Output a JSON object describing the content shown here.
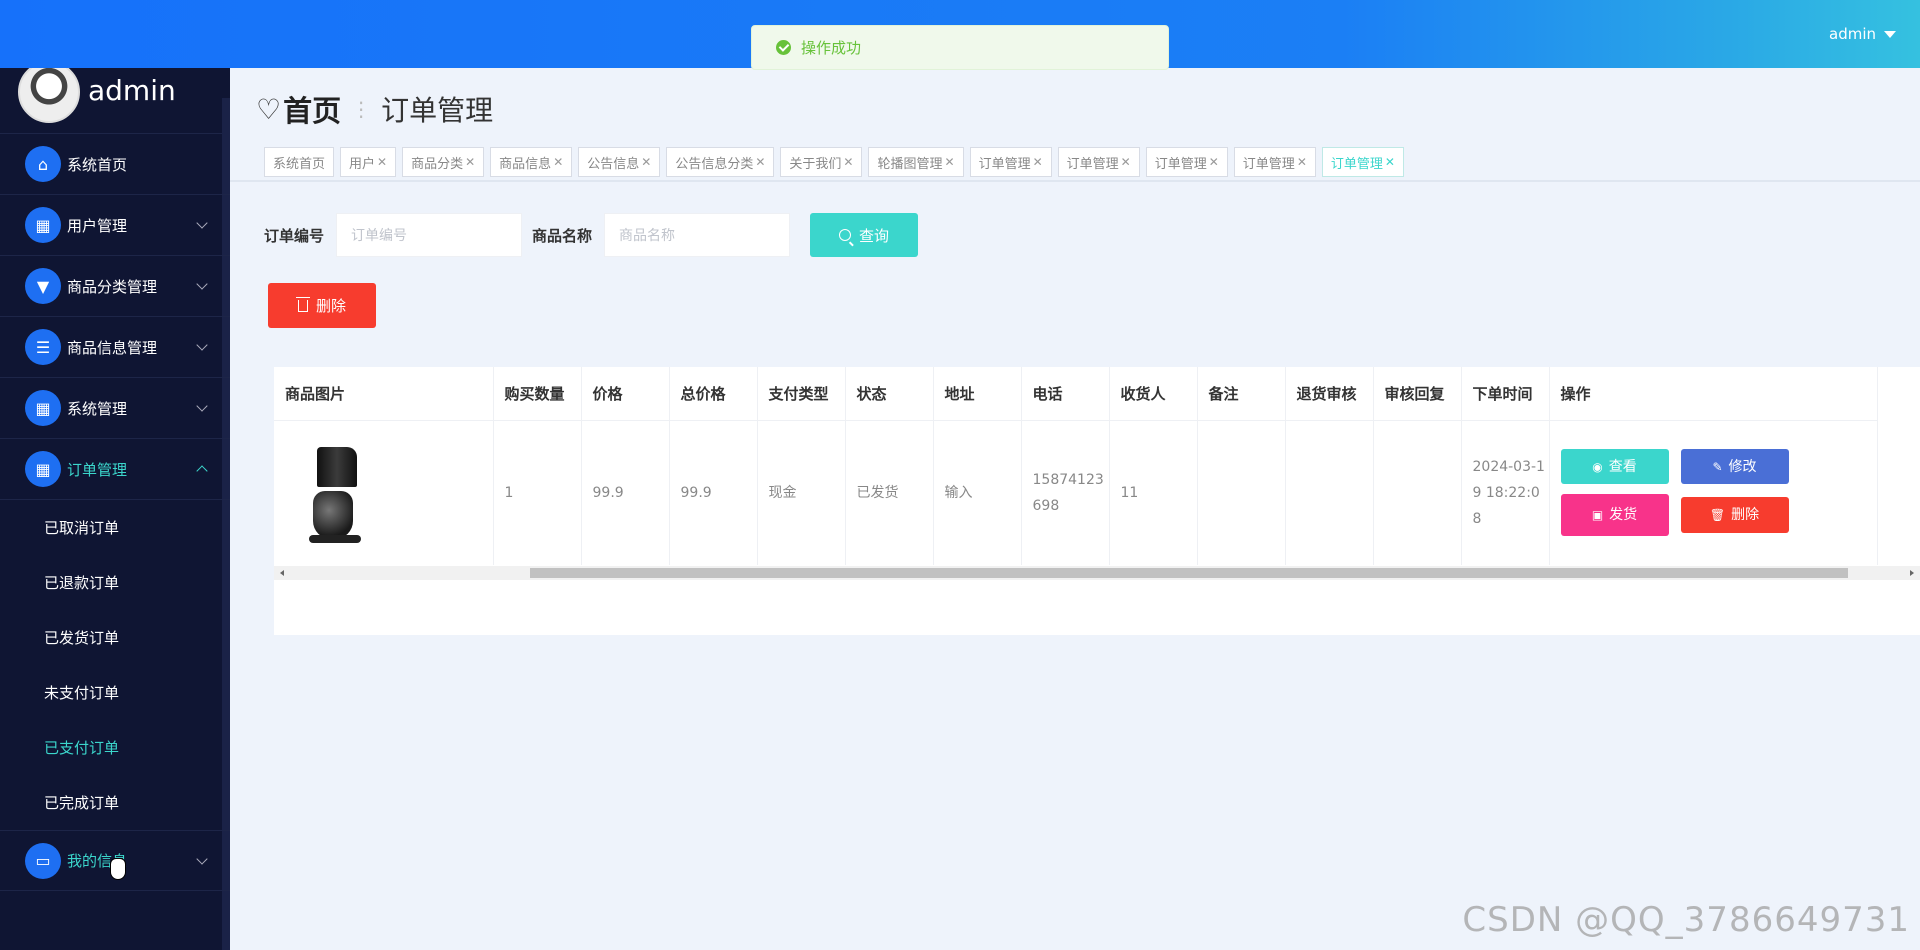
{
  "topbar": {
    "user": "admin"
  },
  "toast": {
    "message": "操作成功"
  },
  "sidebar": {
    "brand_name": "admin",
    "items": [
      {
        "label": "系统首页",
        "icon": "home-icon",
        "expandable": false
      },
      {
        "label": "用户管理",
        "icon": "grid-icon",
        "expandable": true
      },
      {
        "label": "商品分类管理",
        "icon": "brush-icon",
        "expandable": true
      },
      {
        "label": "商品信息管理",
        "icon": "list-icon",
        "expandable": true
      },
      {
        "label": "系统管理",
        "icon": "grid-icon",
        "expandable": true
      },
      {
        "label": "订单管理",
        "icon": "grid-icon",
        "expandable": true,
        "expanded": true
      },
      {
        "label": "我的信息",
        "icon": "card-icon",
        "expandable": true
      }
    ],
    "order_sub": [
      "已取消订单",
      "已退款订单",
      "已发货订单",
      "未支付订单",
      "已支付订单",
      "已完成订单"
    ],
    "active_sub": "已支付订单"
  },
  "breadcrumb": {
    "home": "首页",
    "current": "订单管理"
  },
  "tags": [
    "系统首页",
    "用户",
    "商品分类",
    "商品信息",
    "公告信息",
    "公告信息分类",
    "关于我们",
    "轮播图管理",
    "订单管理",
    "订单管理",
    "订单管理",
    "订单管理",
    "订单管理"
  ],
  "search": {
    "order_no_label": "订单编号",
    "order_no_placeholder": "订单编号",
    "goods_name_label": "商品名称",
    "goods_name_placeholder": "商品名称",
    "button": "查询"
  },
  "toolbar": {
    "delete_label": "删除"
  },
  "table": {
    "headers": [
      "商品图片",
      "购买数量",
      "价格",
      "总价格",
      "支付类型",
      "状态",
      "地址",
      "电话",
      "收货人",
      "备注",
      "退货审核",
      "审核回复",
      "下单时间",
      "操作"
    ],
    "rows": [
      {
        "quantity": "1",
        "price": "99.9",
        "total": "99.9",
        "pay_type": "现金",
        "status": "已发货",
        "address": "输入",
        "phone": "15874123698",
        "receiver": "11",
        "note": "",
        "return_review": "",
        "review_reply": "",
        "order_time": "2024-03-19 18:22:08"
      }
    ],
    "actions": {
      "view": "查看",
      "edit": "修改",
      "ship": "发货",
      "delete": "删除"
    }
  },
  "watermark": "CSDN @QQ_3786649731",
  "colors": {
    "accent": "#3bd6cc",
    "sidebar_bg": "#0f1533",
    "primary_blue": "#1671fa",
    "danger": "#f73c2e",
    "pink": "#f8338a"
  }
}
